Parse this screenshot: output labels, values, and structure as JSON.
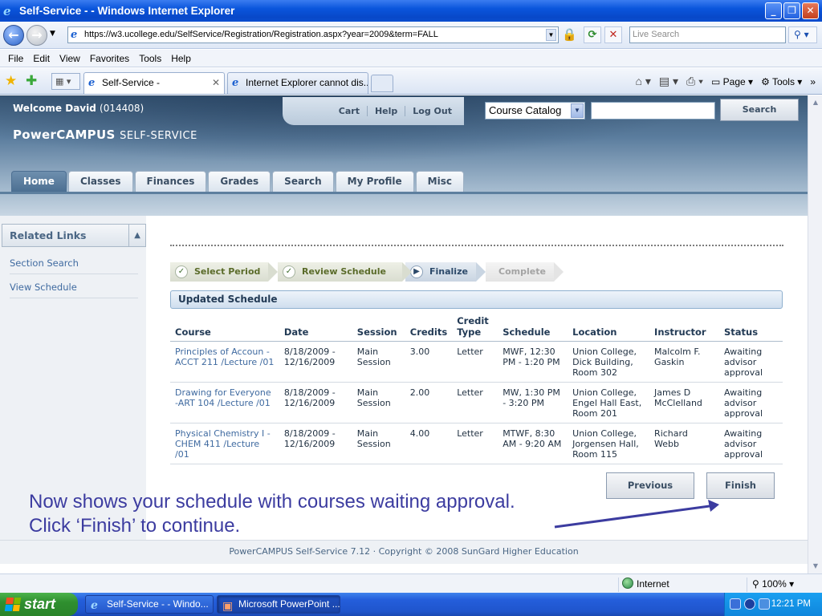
{
  "window": {
    "title": "Self-Service - - Windows Internet Explorer"
  },
  "browser": {
    "url": "https://w3.ucollege.edu/SelfService/Registration/Registration.aspx?year=2009&term=FALL",
    "live_search_placeholder": "Live Search",
    "menu": [
      "File",
      "Edit",
      "View",
      "Favorites",
      "Tools",
      "Help"
    ],
    "tabs": [
      {
        "label": "Self-Service -",
        "active": true
      },
      {
        "label": "Internet Explorer cannot dis...",
        "active": false
      }
    ],
    "command_bar": {
      "page_label": "Page",
      "tools_label": "Tools"
    },
    "status": {
      "zone": "Internet",
      "zoom": "100%"
    }
  },
  "site": {
    "welcome_label": "Welcome David",
    "student_id": "(014408)",
    "brand_main": "PowerCAMPUS",
    "brand_sub": "SELF-SERVICE",
    "top_links": [
      "Cart",
      "Help",
      "Log Out"
    ],
    "catalog_select": "Course Catalog",
    "search_button": "Search",
    "nav_tabs": [
      "Home",
      "Classes",
      "Finances",
      "Grades",
      "Search",
      "My Profile",
      "Misc"
    ],
    "active_tab": "Home",
    "footer": "PowerCAMPUS Self-Service 7.12 · Copyright © 2008 SunGard Higher Education"
  },
  "sidebar": {
    "title": "Related Links",
    "links": [
      "Section Search",
      "View Schedule"
    ]
  },
  "steps": [
    {
      "label": "Select Period",
      "state": "done"
    },
    {
      "label": "Review Schedule",
      "state": "done"
    },
    {
      "label": "Finalize",
      "state": "current"
    },
    {
      "label": "Complete",
      "state": "future"
    }
  ],
  "schedule": {
    "title": "Updated Schedule",
    "columns": [
      "Course",
      "Date",
      "Session",
      "Credits",
      "Credit Type",
      "Schedule",
      "Location",
      "Instructor",
      "Status"
    ],
    "rows": [
      {
        "course": "Principles of Accoun - ACCT 211 /Lecture /01",
        "date": "8/18/2009 - 12/16/2009",
        "session": "Main Session",
        "credits": "3.00",
        "credit_type": "Letter",
        "schedule": "MWF, 12:30 PM - 1:20 PM",
        "location": "Union College, Dick Building, Room 302",
        "instructor": "Malcolm F. Gaskin",
        "status": "Awaiting advisor approval"
      },
      {
        "course": "Drawing for Everyone -ART 104 /Lecture /01",
        "date": "8/18/2009 - 12/16/2009",
        "session": "Main Session",
        "credits": "2.00",
        "credit_type": "Letter",
        "schedule": "MW, 1:30 PM - 3:20 PM",
        "location": "Union College, Engel Hall East, Room 201",
        "instructor": "James D McClelland",
        "status": "Awaiting advisor approval"
      },
      {
        "course": "Physical Chemistry I -CHEM 411 /Lecture /01",
        "date": "8/18/2009 - 12/16/2009",
        "session": "Main Session",
        "credits": "4.00",
        "credit_type": "Letter",
        "schedule": "MTWF, 8:30 AM - 9:20 AM",
        "location": "Union College, Jorgensen Hall, Room 115",
        "instructor": "Richard Webb",
        "status": "Awaiting advisor approval"
      }
    ]
  },
  "buttons": {
    "previous": "Previous",
    "finish": "Finish"
  },
  "annotation": {
    "line1": "Now shows your schedule with courses waiting approval.",
    "line2": "Click ‘Finish’ to continue."
  },
  "taskbar": {
    "start_label": "start",
    "tasks": [
      "Self-Service - - Windo...",
      "Microsoft PowerPoint ..."
    ],
    "clock": "12:21 PM"
  },
  "colors": {
    "titlebar": "#0a55dc",
    "site_header": "#5b7d9e",
    "link": "#3f6aa0",
    "annotation": "#3c3ca0"
  }
}
